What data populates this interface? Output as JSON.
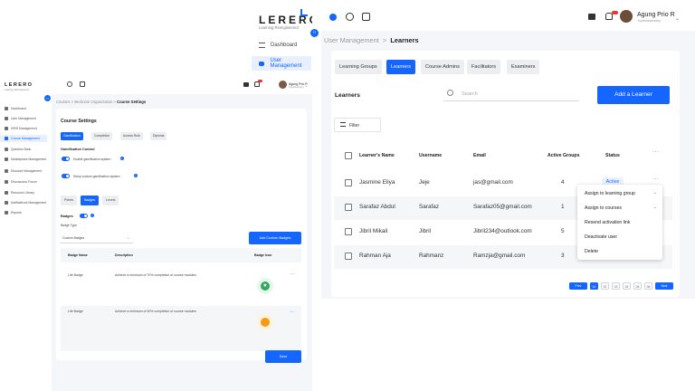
{
  "colors": {
    "accent": "#1565ff",
    "danger": "#e53935",
    "bg": "#f4f6f9"
  },
  "left": {
    "logo": "LERERO",
    "logo_sub": "Learning Reengineered",
    "nav": [
      {
        "label": "Dashboard"
      },
      {
        "label": "User Management"
      },
      {
        "label": "HRIS Management"
      },
      {
        "label": "Course Management"
      },
      {
        "label": "Question Bank"
      },
      {
        "label": "Marketplace Management"
      },
      {
        "label": "Discount Management"
      },
      {
        "label": "Discussions Forum"
      },
      {
        "label": "Resource Library"
      },
      {
        "label": "Notifications Management"
      },
      {
        "label": "Reports"
      }
    ],
    "user_name": "Agung Prio R",
    "user_sub": "Kyawdsabuwoy",
    "breadcrumb": {
      "a": "Courses",
      "b": "Bedroom Organization",
      "c": "Course Settings"
    },
    "card_title": "Course Settings",
    "tabs": [
      "Gamification",
      "Completion",
      "Access Rule",
      "Diploma"
    ],
    "gamification_control": "Gamification Control",
    "toggle1": "Enable gamification system",
    "toggle2": "Setup custom gamification system",
    "tabs2": [
      "Points",
      "Badges",
      "Levels"
    ],
    "badges_label": "Badges",
    "badge_type_label": "Badge Type",
    "badge_type_value": "Custom Badges",
    "add_custom_badges": "Add Custom Badges",
    "table_head": [
      "Badge Name",
      "Description",
      "Badge Icon"
    ],
    "rows": [
      {
        "name": "Life Badge",
        "desc": "Achieve a minimum of 70% completion of course modules"
      },
      {
        "name": "Life Badge",
        "desc": "Achieve a minimum of 40% completion of course modules"
      }
    ],
    "more": "···",
    "save": "Save"
  },
  "mid": {
    "logo": "LERERO",
    "logo_sub": "Learning Reengineered",
    "nav": [
      {
        "label": "Dashboard"
      },
      {
        "label": "User Management"
      }
    ]
  },
  "right": {
    "user_name": "Agung Prio R",
    "user_sub": "Kyawdsabuwoy",
    "breadcrumb": {
      "a": "User Management",
      "b": "Learners"
    },
    "tabs": [
      "Learning Groups",
      "Learners",
      "Course Admins",
      "Facilitators",
      "Examiners"
    ],
    "section_title": "Learners",
    "search_placeholder": "Search",
    "add_learner": "Add a Learner",
    "filter": "Filter",
    "columns": [
      "Learner's Name",
      "Username",
      "Email",
      "Active Groups",
      "Status"
    ],
    "rows": [
      {
        "name": "Jasmine Eliya",
        "username": "Jeje",
        "email": "jas@gmail.com",
        "groups": "4",
        "status": "Active"
      },
      {
        "name": "Sarafaz Abdul",
        "username": "Sarafaz",
        "email": "Sarafaz05@gmail.com",
        "groups": "1"
      },
      {
        "name": "Jibril Mikail",
        "username": "Jibril",
        "email": "Jibril234@outlook.com",
        "groups": "5"
      },
      {
        "name": "Rahman Aja",
        "username": "Rahmanz",
        "email": "Ramzja@gmail.com",
        "groups": "3"
      }
    ],
    "more": "···",
    "menu": [
      "Assign to learning group",
      "Assign to courses",
      "Resend activation link",
      "Deactivate user",
      "Delete"
    ],
    "pager": {
      "prev": "Prev",
      "next": "Next",
      "pages": [
        "01",
        "02",
        "03",
        "04",
        "05",
        "06"
      ]
    }
  }
}
